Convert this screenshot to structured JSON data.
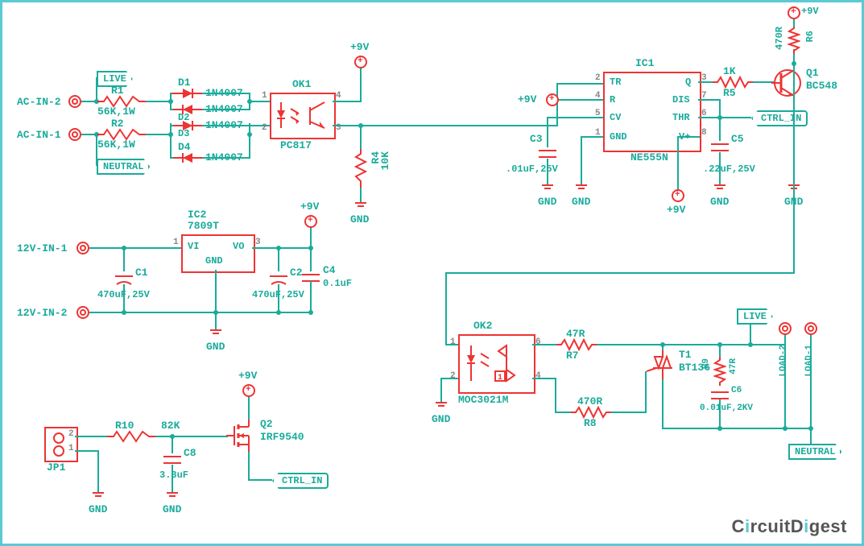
{
  "terminals": {
    "ac_in_2": "AC-IN-2",
    "ac_in_1": "AC-IN-1",
    "dc_in_1": "12V-IN-1",
    "dc_in_2": "12V-IN-2",
    "load_2": "LOAD-2",
    "load_1": "LOAD-1"
  },
  "power": {
    "p9v": "+9V",
    "gnd": "GND"
  },
  "netlabels": {
    "live": "LIVE",
    "neutral": "NEUTRAL",
    "ctrl_in": "CTRL_IN"
  },
  "components": {
    "R1": {
      "ref": "R1",
      "val": "56K,1W"
    },
    "R2": {
      "ref": "R2",
      "val": "56K,1W"
    },
    "R4": {
      "ref": "R4",
      "val": "10K"
    },
    "R5": {
      "ref": "R5",
      "val": "1K"
    },
    "R6": {
      "ref": "R6",
      "val": "470R"
    },
    "R7": {
      "ref": "R7",
      "val": "47R"
    },
    "R8": {
      "ref": "R8",
      "val": "470R"
    },
    "R9": {
      "ref": "R9",
      "val": "47R"
    },
    "R10": {
      "ref": "R10",
      "val": "82K"
    },
    "C1": {
      "ref": "C1",
      "val": "470uF,25V"
    },
    "C2": {
      "ref": "C2",
      "val": "470uF,25V"
    },
    "C3": {
      "ref": "C3",
      "val": ".01uF,25V"
    },
    "C4": {
      "ref": "C4",
      "val": "0.1uF"
    },
    "C5": {
      "ref": "C5",
      "val": ".22uF,25V"
    },
    "C6": {
      "ref": "C6",
      "val": "0.01uF,2KV"
    },
    "C8": {
      "ref": "C8",
      "val": "3.3uF"
    },
    "D1": {
      "ref": "D1",
      "val": "1N4007"
    },
    "D2": {
      "ref": "D2",
      "val": "1N4007"
    },
    "D3": {
      "ref": "D3",
      "val": "1N4007"
    },
    "D4": {
      "ref": "D4",
      "val": "1N4007"
    },
    "OK1": {
      "ref": "OK1",
      "val": "PC817"
    },
    "OK2": {
      "ref": "OK2",
      "val": "MOC3021M"
    },
    "IC1": {
      "ref": "IC1",
      "val": "NE555N",
      "pins": {
        "tr": "TR",
        "q": "Q",
        "r": "R",
        "dis": "DIS",
        "cv": "CV",
        "thr": "THR",
        "gnd": "GND",
        "vp": "V+"
      }
    },
    "IC2": {
      "ref": "IC2",
      "val": "7809T",
      "pins": {
        "vi": "VI",
        "vo": "VO",
        "gnd": "GND"
      }
    },
    "Q1": {
      "ref": "Q1",
      "val": "BC548"
    },
    "Q2": {
      "ref": "Q2",
      "val": "IRF9540"
    },
    "T1": {
      "ref": "T1",
      "val": "BT136"
    },
    "JP1": {
      "ref": "JP1",
      "p1": "1",
      "p2": "2"
    }
  },
  "pin_numbers": {
    "ok1": {
      "p1": "1",
      "p2": "2",
      "p3": "3",
      "p4": "4"
    },
    "ok2": {
      "p1": "1",
      "p2": "2",
      "p4": "4",
      "p6": "6"
    },
    "ic1": {
      "p1": "1",
      "p2": "2",
      "p3": "3",
      "p4": "4",
      "p5": "5",
      "p6": "6",
      "p7": "7",
      "p8": "8"
    },
    "ic2": {
      "p1": "1",
      "p3": "3"
    }
  },
  "watermark": {
    "a": "C",
    "b": "rcuitD",
    "c": "gest",
    "i": "i"
  }
}
